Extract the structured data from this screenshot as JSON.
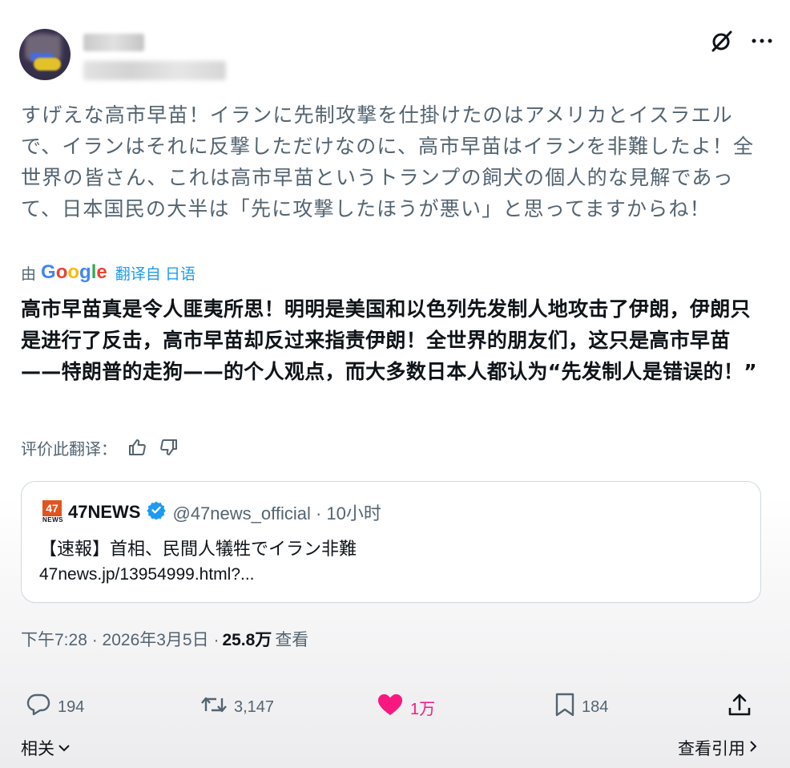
{
  "post": {
    "original_text": "すげえな高市早苗！イランに先制攻撃を仕掛けたのはアメリカとイスラエルで、イランはそれに反撃しただけなのに、高市早苗はイランを非難したよ！全世界の皆さん、これは高市早苗というトランプの飼犬の個人的な見解であって、日本国民の大半は「先に攻撃したほうが悪い」と思ってますからね！",
    "translated_by_prefix": "由",
    "translated_by_brand": "Google",
    "translated_from": "翻译自 日语",
    "translated_text": "高市早苗真是令人匪夷所思！明明是美国和以色列先发制人地攻击了伊朗，伊朗只是进行了反击，高市早苗却反过来指责伊朗！全世界的朋友们，这只是高市早苗——特朗普的走狗——的个人观点，而大多数日本人都认为“先发制人是错误的！”",
    "rate_label": "评价此翻译："
  },
  "quote": {
    "logo_text": "47",
    "logo_sub": "NEWS",
    "name": "47NEWS",
    "handle": "@47news_official · 10小时",
    "text": "【速報】首相、民間人犠牲でイラン非難",
    "link": "47news.jp/13954999.html?..."
  },
  "meta": {
    "time_date": "下午7:28 · 2026年3月5日 ·",
    "views": "25.8万",
    "views_label": "查看"
  },
  "actions": {
    "replies": "194",
    "reposts": "3,147",
    "likes": "1万",
    "bookmarks": "184"
  },
  "footer": {
    "related": "相关",
    "view_quotes": "查看引用"
  },
  "colors": {
    "accent": "#1d9bf0",
    "like": "#f91880",
    "muted": "#536471",
    "verified": "#1d9bf0",
    "news_logo": "#e2541f"
  }
}
